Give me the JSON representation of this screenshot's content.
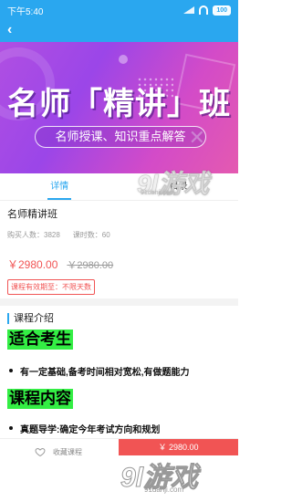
{
  "status_bar": {
    "time": "下午5:40",
    "battery": "100"
  },
  "banner": {
    "title": "名师「精讲」班",
    "subtitle": "名师授课、知识重点解答"
  },
  "tabs": [
    {
      "label": "详情",
      "active": true
    },
    {
      "label": "目录",
      "active": false
    }
  ],
  "course": {
    "name": "名师精讲班",
    "buyers": "购买人数：3828",
    "hours": "课时数：60",
    "price": "￥2980.00",
    "old_price": "￥2980.00",
    "validity": "课程有效期至：不限天数"
  },
  "intro": {
    "section_title": "课程介绍",
    "suitable_heading": "适合考生",
    "suitable_item": "有一定基础,备考时间相对宽松,有做题能力",
    "content_heading": "课程内容",
    "content_item": "真题导学:确定今年考试方向和规划"
  },
  "bottom_bar": {
    "favorite_label": "收藏课程",
    "buy_label": "￥ 2980.00"
  },
  "watermarks": {
    "logo_text": "9l游戏",
    "domain": "91danji.com"
  },
  "colors": {
    "accent": "#2aa7ef",
    "price": "#f15454",
    "highlight": "#33ee44"
  },
  "icons": {
    "back": "back-arrow-icon",
    "favorite": "heart-icon"
  }
}
